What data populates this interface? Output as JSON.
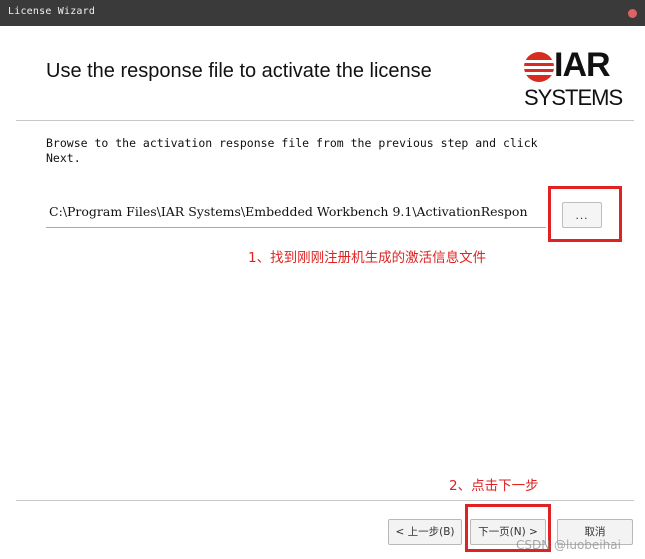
{
  "window": {
    "title": "License Wizard",
    "close_icon": "close-dot-icon"
  },
  "header": {
    "title": "Use the response file to activate the license",
    "logo": {
      "brand_top": "IAR",
      "brand_bottom": "SYSTEMS",
      "accent_color": "#d62d20"
    }
  },
  "main": {
    "instruction": "Browse to the activation response file from the previous step and click\nNext.",
    "file_path": "C:\\Program Files\\IAR Systems\\Embedded Workbench 9.1\\ActivationRespon",
    "browse_label": "..."
  },
  "annotations": {
    "step1": "1、找到刚刚注册机生成的激活信息文件",
    "step2": "2、点击下一步",
    "color": "#e02222"
  },
  "footer": {
    "back_label": "< 上一步(B)",
    "next_label": "下一页(N) >",
    "cancel_label": "取消"
  },
  "watermark": "CSDN @luobeihai"
}
